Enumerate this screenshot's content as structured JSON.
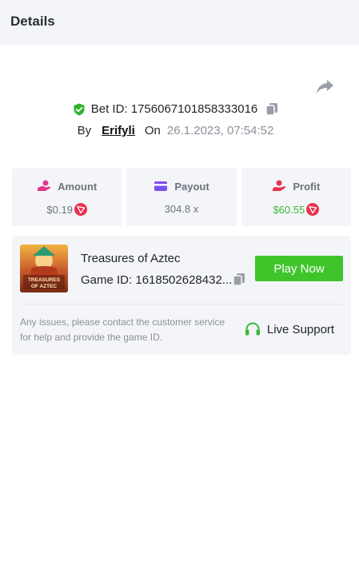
{
  "header": {
    "title": "Details"
  },
  "bet": {
    "id_label": "Bet ID: 1756067101858333016",
    "by_label": "By",
    "user": "Erifyli",
    "on_label": "On",
    "datetime": "26.1.2023, 07:54:52"
  },
  "stats": {
    "amount": {
      "label": "Amount",
      "value": "$0.19",
      "icon": "amount-hand-icon",
      "coin": "tron-coin-icon"
    },
    "payout": {
      "label": "Payout",
      "value": "304.8 x",
      "icon": "card-icon"
    },
    "profit": {
      "label": "Profit",
      "value": "$60.55",
      "icon": "profit-hand-icon",
      "coin": "tron-coin-icon"
    }
  },
  "game": {
    "name": "Treasures of Aztec",
    "id_label": "Game ID: 1618502628432...",
    "thumb_text": "TREASURES OF AZTEC",
    "play_label": "Play Now",
    "support_note": "Any issues, please contact the customer service for help and provide the game ID.",
    "support_label": "Live Support"
  },
  "colors": {
    "accent_green": "#3fc52a",
    "profit_green": "#3bb83b",
    "coin_red": "#e8334f",
    "payout_purple": "#7b4ff0",
    "amount_pink": "#e03a8c",
    "header_bg": "#f4f5f8"
  }
}
